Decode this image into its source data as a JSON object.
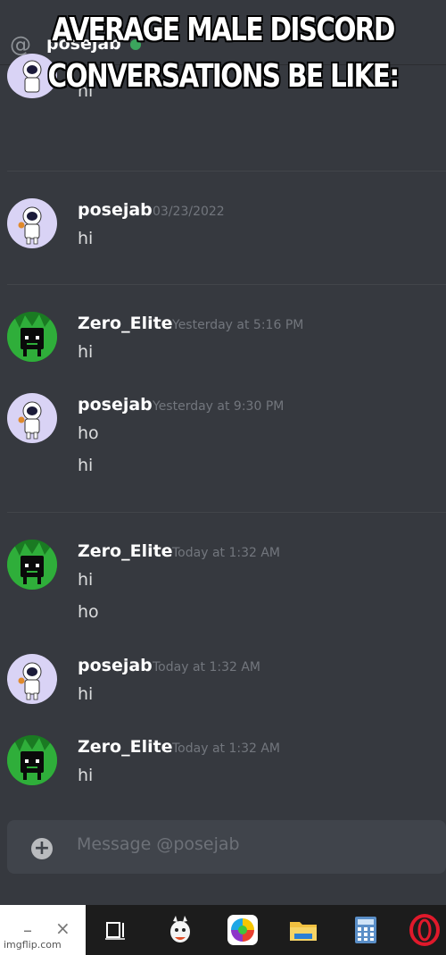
{
  "meme": {
    "caption": "AVERAGE MALE DISCORD CONVERSATIONS BE LIKE:"
  },
  "header": {
    "at_symbol": "@",
    "channel_name": "posejab",
    "status_color": "#3ba55d"
  },
  "messages": [
    {
      "author": "",
      "timestamp": "",
      "lines": [
        "hi"
      ],
      "avatar": "astronaut"
    },
    {
      "author": "posejab",
      "timestamp": "03/23/2022",
      "lines": [
        "hi"
      ],
      "avatar": "astronaut"
    },
    {
      "author": "Zero_Elite",
      "timestamp": "Yesterday at 5:16 PM",
      "lines": [
        "hi"
      ],
      "avatar": "black-cube"
    },
    {
      "author": "posejab",
      "timestamp": "Yesterday at 9:30 PM",
      "lines": [
        "ho",
        "hi"
      ],
      "avatar": "astronaut"
    },
    {
      "author": "Zero_Elite",
      "timestamp": "Today at 1:32 AM",
      "lines": [
        "hi",
        "ho"
      ],
      "avatar": "black-cube"
    },
    {
      "author": "posejab",
      "timestamp": "Today at 1:32 AM",
      "lines": [
        "hi"
      ],
      "avatar": "astronaut"
    },
    {
      "author": "Zero_Elite",
      "timestamp": "Today at 1:32 AM",
      "lines": [
        "hi"
      ],
      "avatar": "black-cube"
    }
  ],
  "composer": {
    "placeholder": "Message @posejab",
    "add_icon": "plus-circle-icon"
  },
  "taskbar": {
    "minimize": "–",
    "close": "×",
    "items": [
      "task-view-icon",
      "llama-app-icon",
      "color-wheel-app-icon",
      "file-explorer-icon",
      "calculator-icon",
      "opera-browser-icon"
    ]
  },
  "watermark": "imgflip.com",
  "colors": {
    "background": "#36393f",
    "composer": "#40444b",
    "muted_text": "#72767d",
    "body_text": "#dcddde"
  }
}
